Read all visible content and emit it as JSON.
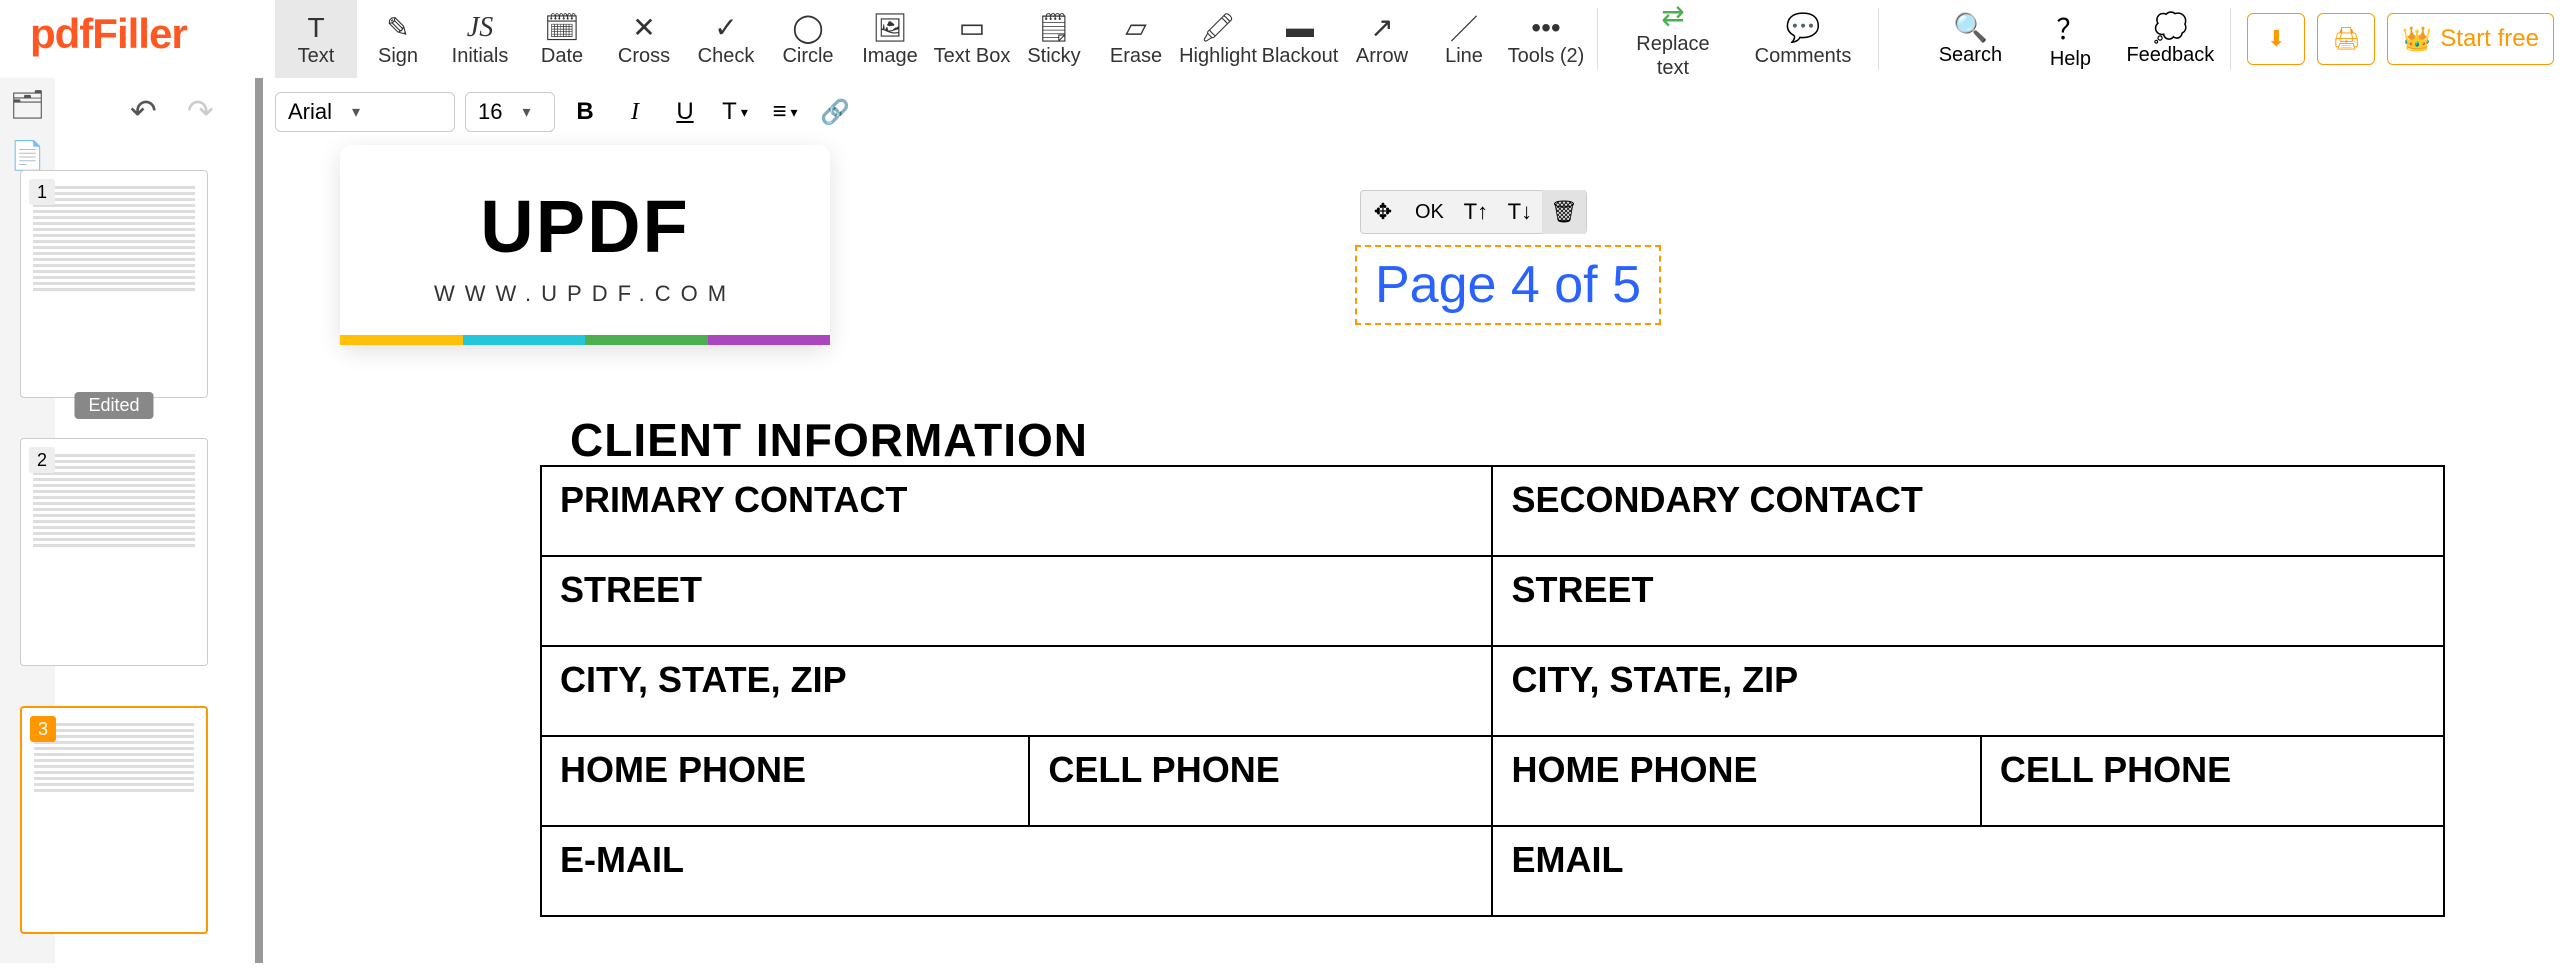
{
  "brand": "pdfFiller",
  "toolbar": {
    "text": "Text",
    "sign": "Sign",
    "initials": "Initials",
    "date": "Date",
    "cross": "Cross",
    "check": "Check",
    "circle": "Circle",
    "image": "Image",
    "textbox": "Text Box",
    "sticky": "Sticky",
    "erase": "Erase",
    "highlight": "Highlight",
    "blackout": "Blackout",
    "arrow": "Arrow",
    "line": "Line",
    "tools": "Tools (2)",
    "replace_text": "Replace\ntext",
    "comments": "Comments",
    "search": "Search",
    "help": "Help",
    "feedback": "Feedback",
    "start_free": "Start free"
  },
  "font": {
    "family": "Arial",
    "size": "16"
  },
  "thumbs": {
    "p1": "1",
    "p2": "2",
    "p3": "3",
    "edited_badge": "Edited"
  },
  "mini": {
    "ok": "OK"
  },
  "page_text": "Page 4 of 5",
  "updf": {
    "name": "UPDF",
    "url": "WWW.UPDF.COM"
  },
  "doc": {
    "heading": "CLIENT INFORMATION",
    "table": {
      "primary": "PRIMARY CONTACT",
      "secondary": "SECONDARY CONTACT",
      "street1": "STREET",
      "street2": "STREET",
      "csz1": "CITY, STATE, ZIP",
      "csz2": "CITY, STATE, ZIP",
      "home1": "HOME PHONE",
      "cell1": "CELL PHONE",
      "home2": "HOME PHONE",
      "cell2": "CELL PHONE",
      "email1": "E-MAIL",
      "email2": "EMAIL"
    }
  }
}
